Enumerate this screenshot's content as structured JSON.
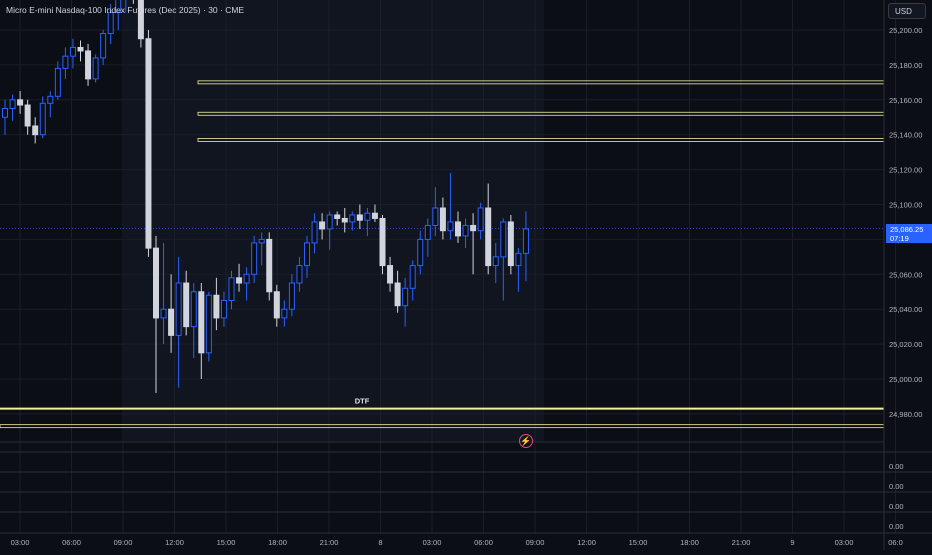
{
  "header": {
    "title": "Micro E-mini Nasdaq-100 Index Futures (Dec 2025) · 30 · CME",
    "currency": "USD"
  },
  "price_badge": {
    "price": "25,086.25",
    "countdown": "07:19"
  },
  "annotations": {
    "dtf_label": "DTF",
    "flash_icon": "lightning-icon"
  },
  "colors": {
    "background": "#0c0e15",
    "up_candle": "#2962ff",
    "down_candle": "#d1d4dc",
    "level_line": "#f5f0a0",
    "dtf_line": "#f5f0a0",
    "price_badge": "#2962ff",
    "flash_icon": "#e2477e"
  },
  "chart_data": {
    "type": "candlestick",
    "title": "Micro E-mini Nasdaq-100 Index Futures (Dec 2025) · 30 · CME",
    "xlabel": "",
    "ylabel": "",
    "ylim": [
      24972,
      25232
    ],
    "y_ticks": [
      "25,200.00",
      "25,180.00",
      "25,160.00",
      "25,140.00",
      "25,120.00",
      "25,100.00",
      "25,080.00",
      "25,060.00",
      "25,040.00",
      "25,020.00",
      "25,000.00",
      "24,980.00"
    ],
    "x_ticks": [
      "03:00",
      "06:00",
      "09:00",
      "12:00",
      "15:00",
      "18:00",
      "21:00",
      "8",
      "03:00",
      "06:00",
      "09:00",
      "12:00",
      "15:00",
      "18:00",
      "21:00",
      "9",
      "03:00",
      "06:0"
    ],
    "candles": [
      {
        "o": 25150,
        "h": 25160,
        "l": 25140,
        "c": 25155
      },
      {
        "o": 25155,
        "h": 25163,
        "l": 25148,
        "c": 25160
      },
      {
        "o": 25160,
        "h": 25165,
        "l": 25152,
        "c": 25157
      },
      {
        "o": 25157,
        "h": 25160,
        "l": 25140,
        "c": 25145
      },
      {
        "o": 25145,
        "h": 25150,
        "l": 25135,
        "c": 25140
      },
      {
        "o": 25140,
        "h": 25162,
        "l": 25138,
        "c": 25158
      },
      {
        "o": 25158,
        "h": 25165,
        "l": 25150,
        "c": 25162
      },
      {
        "o": 25162,
        "h": 25182,
        "l": 25160,
        "c": 25178
      },
      {
        "o": 25178,
        "h": 25190,
        "l": 25172,
        "c": 25185
      },
      {
        "o": 25185,
        "h": 25195,
        "l": 25178,
        "c": 25190
      },
      {
        "o": 25190,
        "h": 25194,
        "l": 25182,
        "c": 25188
      },
      {
        "o": 25188,
        "h": 25192,
        "l": 25168,
        "c": 25172
      },
      {
        "o": 25172,
        "h": 25186,
        "l": 25170,
        "c": 25184
      },
      {
        "o": 25184,
        "h": 25200,
        "l": 25180,
        "c": 25198
      },
      {
        "o": 25198,
        "h": 25215,
        "l": 25192,
        "c": 25210
      },
      {
        "o": 25210,
        "h": 25222,
        "l": 25200,
        "c": 25218
      },
      {
        "o": 25218,
        "h": 25232,
        "l": 25210,
        "c": 25228
      },
      {
        "o": 25228,
        "h": 25232,
        "l": 25215,
        "c": 25222
      },
      {
        "o": 25222,
        "h": 25232,
        "l": 25190,
        "c": 25195
      },
      {
        "o": 25195,
        "h": 25200,
        "l": 25070,
        "c": 25075
      },
      {
        "o": 25075,
        "h": 25082,
        "l": 24992,
        "c": 25035
      },
      {
        "o": 25035,
        "h": 25078,
        "l": 25020,
        "c": 25040
      },
      {
        "o": 25040,
        "h": 25060,
        "l": 25015,
        "c": 25025
      },
      {
        "o": 25025,
        "h": 25070,
        "l": 24995,
        "c": 25055
      },
      {
        "o": 25055,
        "h": 25062,
        "l": 25025,
        "c": 25030
      },
      {
        "o": 25030,
        "h": 25055,
        "l": 25012,
        "c": 25050
      },
      {
        "o": 25050,
        "h": 25055,
        "l": 25000,
        "c": 25015
      },
      {
        "o": 25015,
        "h": 25050,
        "l": 25010,
        "c": 25048
      },
      {
        "o": 25048,
        "h": 25058,
        "l": 25028,
        "c": 25035
      },
      {
        "o": 25035,
        "h": 25050,
        "l": 25030,
        "c": 25045
      },
      {
        "o": 25045,
        "h": 25062,
        "l": 25040,
        "c": 25058
      },
      {
        "o": 25058,
        "h": 25066,
        "l": 25050,
        "c": 25055
      },
      {
        "o": 25055,
        "h": 25064,
        "l": 25045,
        "c": 25060
      },
      {
        "o": 25060,
        "h": 25082,
        "l": 25055,
        "c": 25078
      },
      {
        "o": 25078,
        "h": 25084,
        "l": 25065,
        "c": 25080
      },
      {
        "o": 25080,
        "h": 25084,
        "l": 25045,
        "c": 25050
      },
      {
        "o": 25050,
        "h": 25054,
        "l": 25030,
        "c": 25035
      },
      {
        "o": 25035,
        "h": 25045,
        "l": 25030,
        "c": 25040
      },
      {
        "o": 25040,
        "h": 25060,
        "l": 25036,
        "c": 25055
      },
      {
        "o": 25055,
        "h": 25070,
        "l": 25050,
        "c": 25065
      },
      {
        "o": 25065,
        "h": 25082,
        "l": 25058,
        "c": 25078
      },
      {
        "o": 25078,
        "h": 25095,
        "l": 25072,
        "c": 25090
      },
      {
        "o": 25090,
        "h": 25095,
        "l": 25080,
        "c": 25086
      },
      {
        "o": 25086,
        "h": 25096,
        "l": 25074,
        "c": 25094
      },
      {
        "o": 25094,
        "h": 25096,
        "l": 25088,
        "c": 25092
      },
      {
        "o": 25092,
        "h": 25098,
        "l": 25084,
        "c": 25090
      },
      {
        "o": 25090,
        "h": 25096,
        "l": 25085,
        "c": 25094
      },
      {
        "o": 25094,
        "h": 25100,
        "l": 25086,
        "c": 25091
      },
      {
        "o": 25091,
        "h": 25098,
        "l": 25082,
        "c": 25095
      },
      {
        "o": 25095,
        "h": 25100,
        "l": 25090,
        "c": 25092
      },
      {
        "o": 25092,
        "h": 25094,
        "l": 25060,
        "c": 25065
      },
      {
        "o": 25065,
        "h": 25070,
        "l": 25050,
        "c": 25055
      },
      {
        "o": 25055,
        "h": 25062,
        "l": 25038,
        "c": 25042
      },
      {
        "o": 25042,
        "h": 25058,
        "l": 25030,
        "c": 25052
      },
      {
        "o": 25052,
        "h": 25068,
        "l": 25045,
        "c": 25065
      },
      {
        "o": 25065,
        "h": 25085,
        "l": 25060,
        "c": 25080
      },
      {
        "o": 25080,
        "h": 25092,
        "l": 25070,
        "c": 25088
      },
      {
        "o": 25088,
        "h": 25110,
        "l": 25082,
        "c": 25098
      },
      {
        "o": 25098,
        "h": 25104,
        "l": 25080,
        "c": 25085
      },
      {
        "o": 25085,
        "h": 25118,
        "l": 25080,
        "c": 25090
      },
      {
        "o": 25090,
        "h": 25096,
        "l": 25078,
        "c": 25082
      },
      {
        "o": 25082,
        "h": 25092,
        "l": 25075,
        "c": 25088
      },
      {
        "o": 25088,
        "h": 25095,
        "l": 25060,
        "c": 25085
      },
      {
        "o": 25085,
        "h": 25101,
        "l": 25080,
        "c": 25098
      },
      {
        "o": 25098,
        "h": 25112,
        "l": 25060,
        "c": 25065
      },
      {
        "o": 25065,
        "h": 25078,
        "l": 25055,
        "c": 25070
      },
      {
        "o": 25070,
        "h": 25092,
        "l": 25045,
        "c": 25090
      },
      {
        "o": 25090,
        "h": 25094,
        "l": 25060,
        "c": 25065
      },
      {
        "o": 25065,
        "h": 25075,
        "l": 25050,
        "c": 25072
      },
      {
        "o": 25072,
        "h": 25096,
        "l": 25056,
        "c": 25086
      }
    ],
    "horizontal_levels": [
      25170,
      25152,
      25137
    ],
    "dtf_level": {
      "label": "DTF",
      "price": 24983,
      "start_candle": 20
    },
    "current_price": 25086.25,
    "lower_pane_values": [
      "0.00",
      "0.00",
      "0.00",
      "0.00"
    ]
  }
}
